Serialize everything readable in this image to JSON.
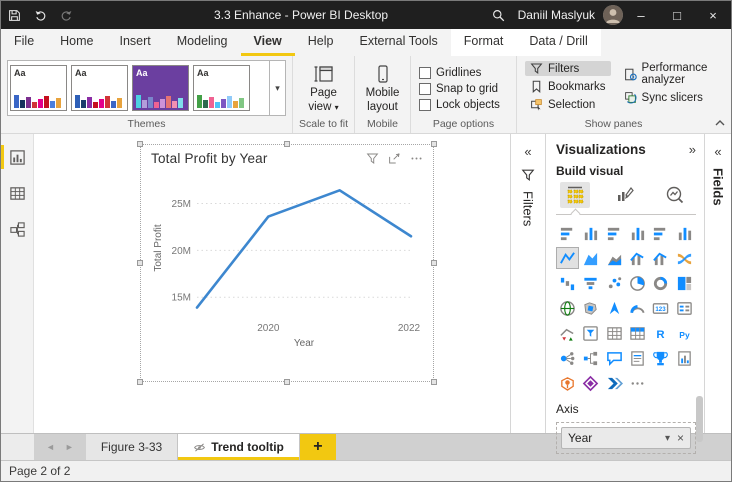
{
  "titlebar": {
    "title": "3.3 Enhance - Power BI Desktop",
    "user_name": "Daniil Maslyuk",
    "quick_access": [
      "save-icon",
      "undo-icon",
      "redo-icon"
    ],
    "search_icon": "search-icon",
    "window_controls": {
      "minimize": "–",
      "maximize": "□",
      "close": "×"
    }
  },
  "ribbon_tabs": [
    {
      "label": "File"
    },
    {
      "label": "Home"
    },
    {
      "label": "Insert"
    },
    {
      "label": "Modeling"
    },
    {
      "label": "View",
      "active": true
    },
    {
      "label": "Help"
    },
    {
      "label": "External Tools"
    },
    {
      "label": "Format",
      "contextual": true
    },
    {
      "label": "Data / Drill",
      "contextual": true
    }
  ],
  "ribbon": {
    "themes": {
      "group_label": "Themes",
      "more_icon": "chevron-down-icon",
      "items": [
        {
          "name": "theme-1",
          "text": "Aa",
          "bg": "#ffffff",
          "fg": "#323130",
          "bars": [
            "#3a66c6",
            "#16325c",
            "#7b2f8f",
            "#d13438",
            "#e3008c",
            "#c50f1f",
            "#4a7edd",
            "#e8a33d"
          ]
        },
        {
          "name": "theme-2",
          "text": "Aa",
          "bg": "#ffffff",
          "fg": "#323130",
          "bars": [
            "#2e5fb7",
            "#1a3a6b",
            "#8a2da5",
            "#c50f1f",
            "#e3008c",
            "#d13438",
            "#3a66c6",
            "#e8a33d"
          ]
        },
        {
          "name": "theme-3",
          "text": "Aa",
          "bg": "#6b3fa0",
          "fg": "#ffffff",
          "bars": [
            "#4dd0e1",
            "#b39ddb",
            "#7986cb",
            "#f06292",
            "#ce93d8",
            "#e57373",
            "#f48fb1",
            "#80deea"
          ]
        },
        {
          "name": "theme-4",
          "text": "Aa",
          "bg": "#ffffff",
          "fg": "#323130",
          "bars": [
            "#43a047",
            "#2d6a4f",
            "#f06292",
            "#4fc3f7",
            "#7e57c2",
            "#90caf9",
            "#e8a33d",
            "#81c784"
          ]
        }
      ]
    },
    "scale_to_fit": {
      "group_label": "Scale to fit",
      "button_label": "Page view",
      "icon": "page-view-icon",
      "dropdown_icon": "chevron-down-icon"
    },
    "mobile": {
      "group_label": "Mobile",
      "button_label": "Mobile layout",
      "icon": "mobile-layout-icon"
    },
    "page_options": {
      "group_label": "Page options",
      "checkboxes": [
        {
          "label": "Gridlines",
          "checked": false
        },
        {
          "label": "Snap to grid",
          "checked": false
        },
        {
          "label": "Lock objects",
          "checked": false
        }
      ]
    },
    "show_panes": {
      "group_label": "Show panes",
      "items": [
        {
          "label": "Filters",
          "icon": "filter-icon",
          "active": true,
          "col": 1
        },
        {
          "label": "Bookmarks",
          "icon": "bookmark-icon",
          "col": 1
        },
        {
          "label": "Selection",
          "icon": "selection-icon",
          "col": 1
        },
        {
          "label": "Performance analyzer",
          "icon": "performance-analyzer-icon",
          "col": 2
        },
        {
          "label": "Sync slicers",
          "icon": "sync-slicers-icon",
          "col": 2
        }
      ]
    },
    "collapse_icon": "chevron-up-icon"
  },
  "sidebar": {
    "views": [
      {
        "name": "report-view",
        "icon": "report-view-icon",
        "selected": true
      },
      {
        "name": "data-view",
        "icon": "data-view-icon",
        "selected": false
      },
      {
        "name": "model-view",
        "icon": "model-view-icon",
        "selected": false
      }
    ]
  },
  "canvas": {
    "visual": {
      "title": "Total Profit by Year",
      "selected": true,
      "header_icons": [
        "filter-icon",
        "focus-mode-icon",
        "more-options-icon"
      ]
    }
  },
  "chart_data": {
    "type": "line",
    "title": "Total Profit by Year",
    "series": [
      {
        "name": "Total Profit",
        "x": [
          2019,
          2020,
          2021,
          2022
        ],
        "values_millions": [
          13.9,
          23.6,
          26.4,
          21.5
        ]
      }
    ],
    "xlabel": "Year",
    "ylabel": "Total Profit",
    "xticks": [
      "2020",
      "2022"
    ],
    "xtick_values": [
      2020,
      2022
    ],
    "yticks": [
      "15M",
      "20M",
      "25M"
    ],
    "ytick_values": [
      15,
      20,
      25
    ],
    "xlim": [
      2019,
      2022
    ],
    "ylim_millions": [
      13,
      27.5
    ],
    "grid": "dotted-horizontal",
    "legend": "none",
    "line_color": "#3D87CF"
  },
  "filters_pane": {
    "title": "Filters",
    "collapsed": true,
    "collapse_icon": "chevron-double-left-icon",
    "icon": "filter-icon"
  },
  "visualizations_pane": {
    "title": "Visualizations",
    "expand_icon": "chevron-double-right-icon",
    "section_label": "Build visual",
    "tools": [
      {
        "name": "build-visual",
        "selected": true
      },
      {
        "name": "format-visual",
        "selected": false
      },
      {
        "name": "analytics",
        "selected": false
      }
    ],
    "gallery": [
      {
        "name": "stacked-bar-chart",
        "type": "barsH"
      },
      {
        "name": "stacked-column-chart",
        "type": "barsV"
      },
      {
        "name": "clustered-bar-chart",
        "type": "barsH"
      },
      {
        "name": "clustered-column-chart",
        "type": "barsV"
      },
      {
        "name": "100-stacked-bar-chart",
        "type": "barsH"
      },
      {
        "name": "100-stacked-column-chart",
        "type": "barsV"
      },
      {
        "name": "line-chart",
        "type": "line",
        "selected": true
      },
      {
        "name": "area-chart",
        "type": "area"
      },
      {
        "name": "stacked-area-chart",
        "type": "areaStack"
      },
      {
        "name": "line-and-stacked-column-chart",
        "type": "combo"
      },
      {
        "name": "line-and-clustered-column-chart",
        "type": "combo"
      },
      {
        "name": "ribbon-chart",
        "type": "ribbon",
        "color": "#e8a33d"
      },
      {
        "name": "waterfall-chart",
        "type": "waterfall"
      },
      {
        "name": "funnel-chart",
        "type": "funnel"
      },
      {
        "name": "scatter-chart",
        "type": "scatter"
      },
      {
        "name": "pie-chart",
        "type": "pie"
      },
      {
        "name": "donut-chart",
        "type": "donut"
      },
      {
        "name": "treemap",
        "type": "treemap"
      },
      {
        "name": "map",
        "type": "globe",
        "color": "#107c10"
      },
      {
        "name": "filled-map",
        "type": "fillmap"
      },
      {
        "name": "azure-map",
        "type": "arrowNav"
      },
      {
        "name": "gauge",
        "type": "gauge"
      },
      {
        "name": "card",
        "type": "cardNum"
      },
      {
        "name": "multi-row-card",
        "type": "multicard"
      },
      {
        "name": "kpi",
        "type": "kpi"
      },
      {
        "name": "slicer",
        "type": "slicer"
      },
      {
        "name": "table",
        "type": "grid"
      },
      {
        "name": "matrix",
        "type": "matrix"
      },
      {
        "name": "r-script-visual",
        "type": "text",
        "text": "R"
      },
      {
        "name": "python-visual",
        "type": "text",
        "text": "Py"
      },
      {
        "name": "key-influencers",
        "type": "influencer"
      },
      {
        "name": "decomposition-tree",
        "type": "tree"
      },
      {
        "name": "q-and-a",
        "type": "bubble"
      },
      {
        "name": "smart-narrative",
        "type": "narrative"
      },
      {
        "name": "goals",
        "type": "trophy"
      },
      {
        "name": "paginated-report",
        "type": "report"
      },
      {
        "name": "arcgis-maps",
        "type": "arcgis",
        "color": "#e8762c"
      },
      {
        "name": "power-apps-visual",
        "type": "powerapps",
        "color": "#8a2da5"
      },
      {
        "name": "power-automate-visual",
        "type": "automate",
        "color": "#0d6bbd"
      },
      {
        "name": "more-visuals",
        "type": "dots"
      }
    ],
    "axis_section": {
      "label": "Axis",
      "field": {
        "value": "Year",
        "dropdown_icon": "chevron-down-icon",
        "remove_icon": "close-icon"
      }
    }
  },
  "fields_pane": {
    "title": "Fields",
    "collapsed": true,
    "collapse_icon": "chevron-double-left-icon"
  },
  "page_tabs": {
    "prev_icon": "prev-page-arrow-icon",
    "next_icon": "next-page-arrow-icon",
    "tabs": [
      {
        "label": "Figure 3-33",
        "active": false
      },
      {
        "label": "Trend tooltip",
        "active": true,
        "icon": "hidden-page-icon"
      }
    ],
    "new_page_label": "+"
  },
  "statusbar": {
    "text": "Page 2 of 2"
  },
  "colors": {
    "accent_yellow": "#F2C811",
    "titlebar": "#1f1f1f",
    "line_blue": "#3D87CF",
    "gallery_blue": "#118DFF",
    "gallery_gray": "#8a8886"
  }
}
